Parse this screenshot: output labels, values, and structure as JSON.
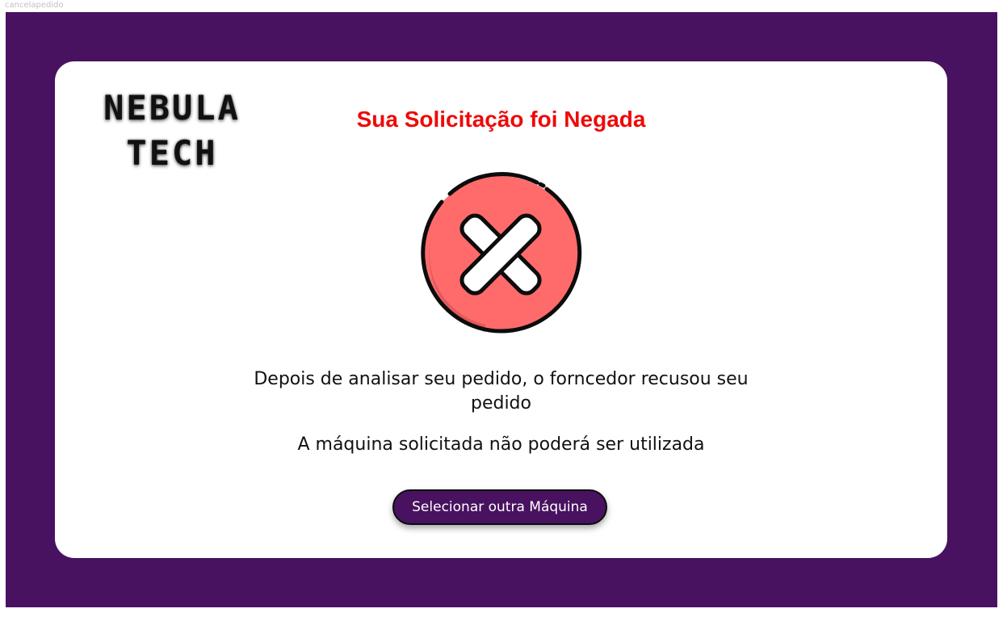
{
  "frame": {
    "label": "cancelapedido"
  },
  "logo": {
    "line1": "NEBULA",
    "line2": "TECH"
  },
  "header": {
    "title": "Sua Solicitação foi Negada"
  },
  "status_icon": "red-circle-x-icon",
  "messages": {
    "analysis": "Depois de analisar seu pedido, o forncedor recusou seu pedido",
    "machine": "A máquina solicitada não poderá ser utilizada"
  },
  "actions": {
    "select_other_label": "Selecionar outra Máquina"
  },
  "colors": {
    "frame_background": "#481260",
    "card_background": "#ffffff",
    "title": "#ee0a0a",
    "icon_fill": "#ff6b6b",
    "icon_shade": "#e0595f",
    "button_background": "#481260",
    "button_text": "#ffffff"
  }
}
